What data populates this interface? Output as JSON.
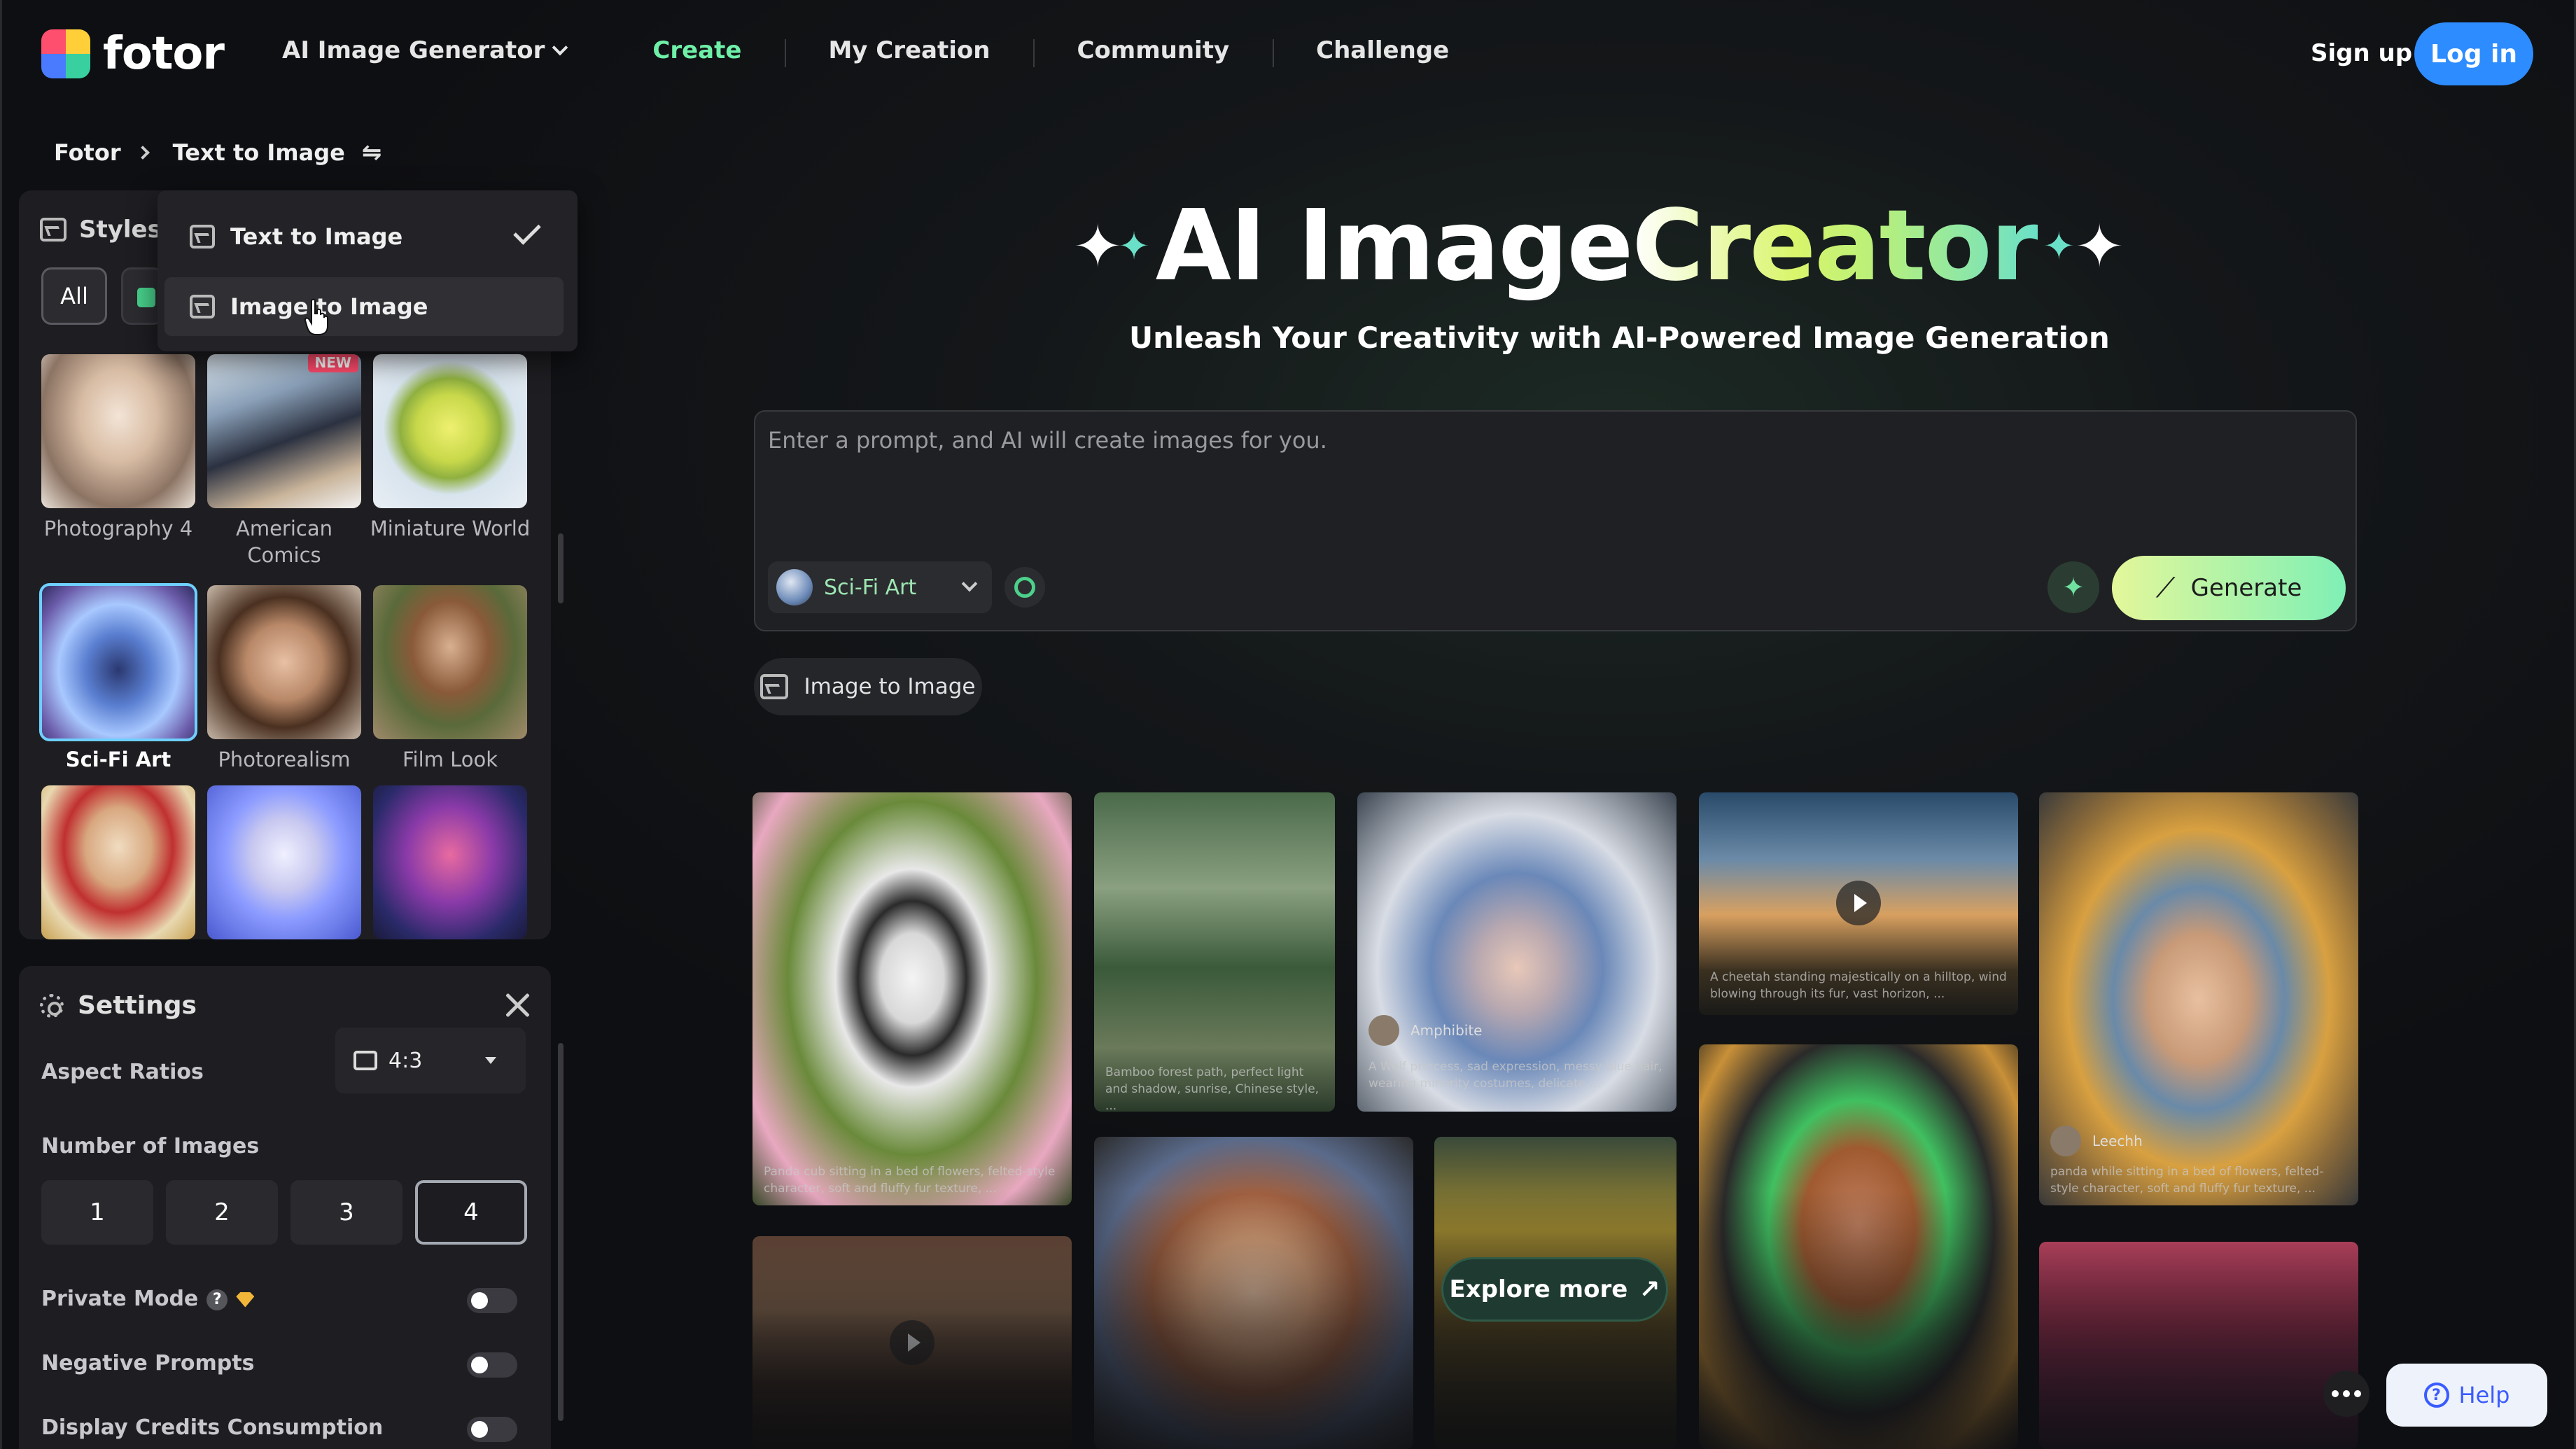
{
  "app": {
    "logo_text": "fotor"
  },
  "nav": {
    "items": [
      {
        "label": "AI Image Generator",
        "has_dropdown": true
      },
      {
        "label": "Create",
        "active": true
      },
      {
        "label": "My Creation"
      },
      {
        "label": "Community"
      },
      {
        "label": "Challenge"
      }
    ],
    "signup": "Sign up",
    "login": "Log in"
  },
  "breadcrumb": {
    "root": "Fotor",
    "current": "Text to Image",
    "swap_icon": "⇋"
  },
  "dropdown": {
    "items": [
      {
        "label": "Text to Image",
        "selected": true
      },
      {
        "label": "Image to Image",
        "hovered": true
      }
    ]
  },
  "styles": {
    "title": "Styles",
    "filter_all": "All",
    "tiles": [
      {
        "label": "Photography 4"
      },
      {
        "label": "American Comics",
        "badge": "NEW"
      },
      {
        "label": "Miniature World"
      },
      {
        "label": "Sci-Fi Art",
        "selected": true
      },
      {
        "label": "Photorealism"
      },
      {
        "label": "Film Look"
      },
      {
        "label": ""
      },
      {
        "label": ""
      },
      {
        "label": ""
      }
    ]
  },
  "settings": {
    "title": "Settings",
    "aspect_label": "Aspect Ratios",
    "aspect_value": "4:3",
    "number_label": "Number of Images",
    "numbers": [
      "1",
      "2",
      "3",
      "4"
    ],
    "number_selected": "4",
    "private_mode": "Private Mode",
    "negative_prompts": "Negative Prompts",
    "display_credits": "Display Credits Consumption"
  },
  "hero": {
    "title_white": "AI Image ",
    "title_gradient": "Creator",
    "subtitle": "Unleash Your Creativity with AI-Powered Image Generation"
  },
  "prompt": {
    "placeholder": "Enter a prompt, and AI will create images for you.",
    "style": "Sci-Fi Art",
    "generate": "Generate"
  },
  "image_to_image": "Image to Image",
  "gallery": {
    "captions": [
      "Panda cub sitting in a bed of flowers, felted-style character, soft and fluffy fur texture, ...",
      "Bamboo forest path, perfect light and shadow, sunrise, Chinese style, ...",
      "A Wolf princess, sad expression, messy blue hair, wearing minority costumes, delicate ...",
      "A cheetah standing majestically on a hilltop, wind blowing through its fur, vast horizon, ...",
      "panda while sitting in a bed of flowers, felted-style character, soft and fluffy fur texture, ..."
    ],
    "users": [
      "Amphibite",
      "Leechh"
    ],
    "explore": "Explore more"
  },
  "help": "Help",
  "colors": {
    "accent_green": "#6ff0a8",
    "login_blue": "#2d8cff",
    "panel": "#1e1e22"
  }
}
